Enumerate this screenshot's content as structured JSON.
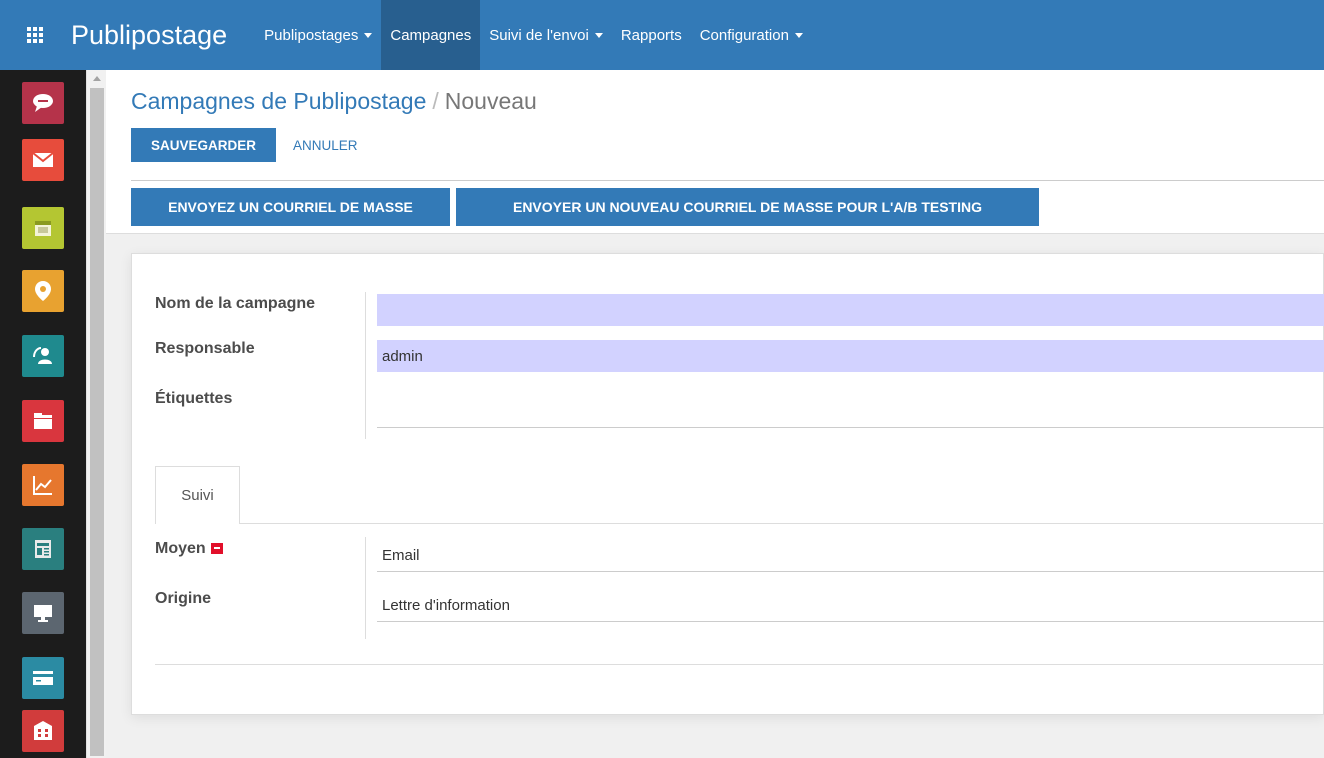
{
  "app": {
    "title": "Publipostage"
  },
  "menu": [
    {
      "label": "Publipostages",
      "dropdown": true,
      "active": false
    },
    {
      "label": "Campagnes",
      "dropdown": false,
      "active": true
    },
    {
      "label": "Suivi de l'envoi",
      "dropdown": true,
      "active": false
    },
    {
      "label": "Rapports",
      "dropdown": false,
      "active": false
    },
    {
      "label": "Configuration",
      "dropdown": true,
      "active": false
    }
  ],
  "sidebar": {
    "items": [
      {
        "icon": "chat-icon",
        "color": "#b5334a"
      },
      {
        "icon": "envelope-icon",
        "color": "#e74c3c"
      },
      {
        "icon": "calendar-icon",
        "color": "#b4c632"
      },
      {
        "icon": "map-pin-icon",
        "color": "#e8a230"
      },
      {
        "icon": "contacts-icon",
        "color": "#1f8a8e"
      },
      {
        "icon": "folder-icon",
        "color": "#d9363e"
      },
      {
        "icon": "chart-icon",
        "color": "#e6772e"
      },
      {
        "icon": "newspaper-icon",
        "color": "#2a7f7f"
      },
      {
        "icon": "monitor-icon",
        "color": "#5c6670"
      },
      {
        "icon": "card-icon",
        "color": "#2b8ba3"
      },
      {
        "icon": "building-icon",
        "color": "#d13c3c"
      }
    ]
  },
  "breadcrumb": {
    "parent": "Campagnes de Publipostage",
    "separator": "/",
    "current": "Nouveau"
  },
  "buttons": {
    "save": "SAUVEGARDER",
    "cancel": "ANNULER",
    "send_mass": "ENVOYEZ UN COURRIEL DE MASSE",
    "send_ab": "ENVOYER UN NOUVEAU COURRIEL DE MASSE POUR L'A/B TESTING"
  },
  "form": {
    "name_label": "Nom de la campagne",
    "name_value": "",
    "responsible_label": "Responsable",
    "responsible_value": "admin",
    "tags_label": "Étiquettes",
    "tags_value": ""
  },
  "tabs": [
    {
      "label": "Suivi"
    }
  ],
  "tracking": {
    "medium_label": "Moyen",
    "medium_value": "Email",
    "source_label": "Origine",
    "source_value": "Lettre d'information"
  },
  "colors": {
    "primary": "#337ab7",
    "required_field": "#d2d2ff"
  }
}
